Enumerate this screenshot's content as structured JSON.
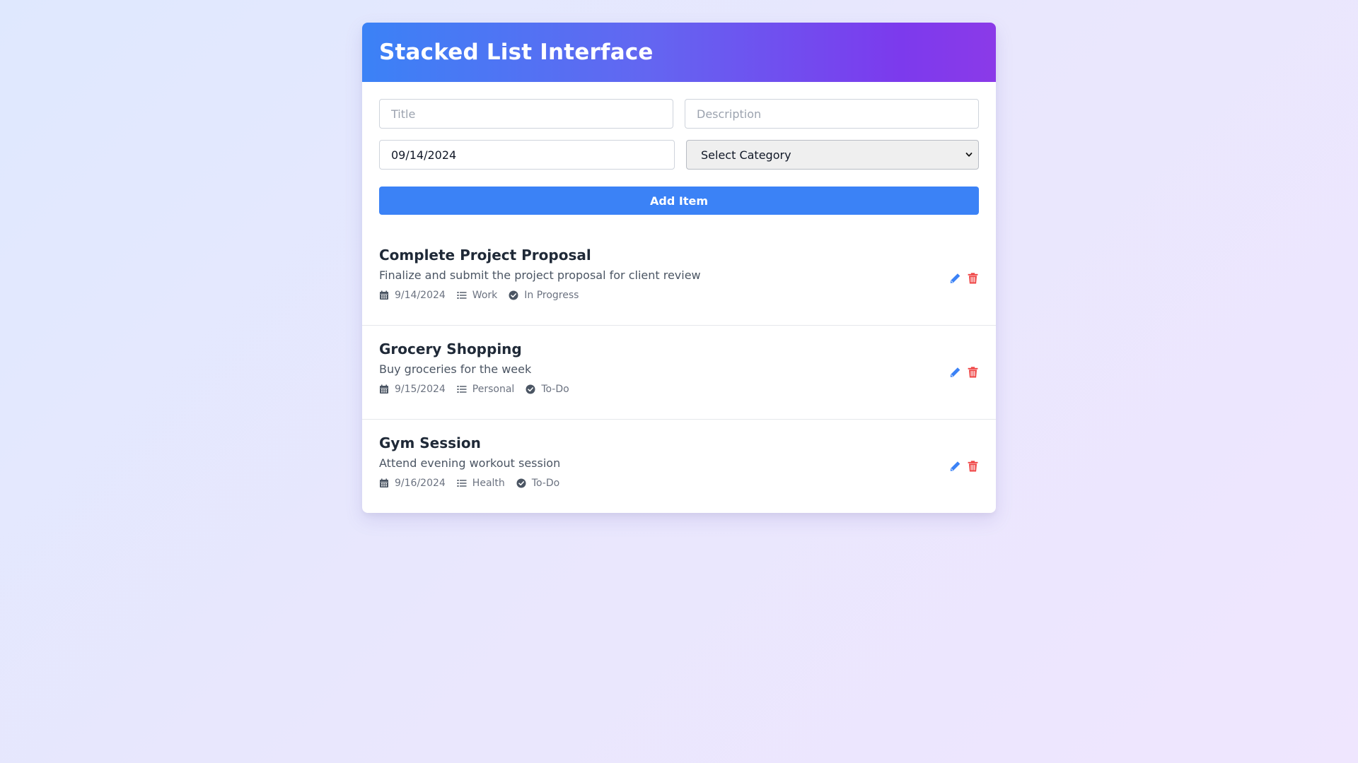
{
  "header": {
    "title": "Stacked List Interface"
  },
  "form": {
    "title_placeholder": "Title",
    "description_placeholder": "Description",
    "date_value": "09/14/2024",
    "category_selected": "Select Category",
    "add_button_label": "Add Item"
  },
  "colors": {
    "primary": "#3b82f6",
    "accent_purple": "#8b3ae8",
    "edit": "#3b82f6",
    "delete": "#ef4444"
  },
  "items": [
    {
      "title": "Complete Project Proposal",
      "description": "Finalize and submit the project proposal for client review",
      "date": "9/14/2024",
      "category": "Work",
      "status": "In Progress"
    },
    {
      "title": "Grocery Shopping",
      "description": "Buy groceries for the week",
      "date": "9/15/2024",
      "category": "Personal",
      "status": "To-Do"
    },
    {
      "title": "Gym Session",
      "description": "Attend evening workout session",
      "date": "9/16/2024",
      "category": "Health",
      "status": "To-Do"
    }
  ],
  "icons": {
    "date": "calendar-icon",
    "category": "list-icon",
    "status": "check-circle-icon",
    "edit": "pencil-icon",
    "delete": "trash-icon"
  }
}
